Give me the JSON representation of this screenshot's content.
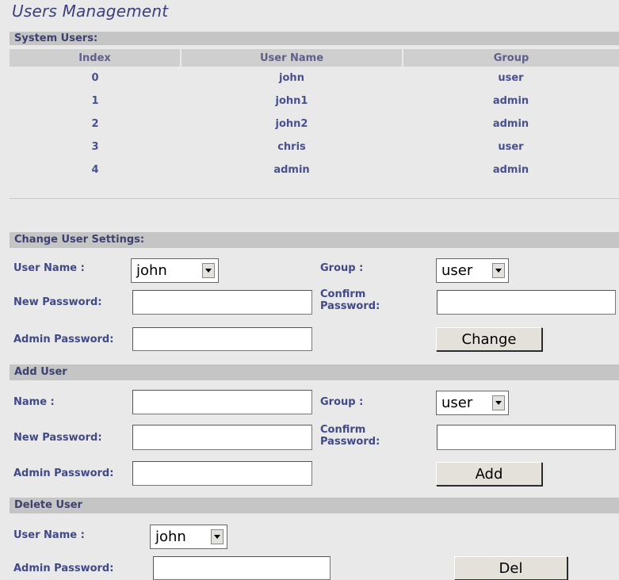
{
  "page": {
    "title": "Users Management"
  },
  "system_users": {
    "header": "System Users:",
    "columns": [
      "Index",
      "User Name",
      "Group"
    ],
    "rows": [
      [
        "0",
        "john",
        "user"
      ],
      [
        "1",
        "john1",
        "admin"
      ],
      [
        "2",
        "john2",
        "admin"
      ],
      [
        "3",
        "chris",
        "user"
      ],
      [
        "4",
        "admin",
        "admin"
      ]
    ]
  },
  "change_user": {
    "header": "Change User Settings:",
    "user_name_label": "User Name :",
    "user_name_value": "john",
    "group_label": "Group :",
    "group_value": "user",
    "new_password_label": "New Password:",
    "confirm_password_label_1": "Confirm",
    "confirm_password_label_2": "Password:",
    "admin_password_label": "Admin Password:",
    "button_label": "Change"
  },
  "add_user": {
    "header": "Add User",
    "name_label": "Name :",
    "group_label": "Group :",
    "group_value": "user",
    "new_password_label": "New Password:",
    "confirm_password_label_1": "Confirm",
    "confirm_password_label_2": "Password:",
    "admin_password_label": "Admin Password:",
    "button_label": "Add"
  },
  "delete_user": {
    "header": "Delete User",
    "user_name_label": "User Name :",
    "user_name_value": "john",
    "admin_password_label": "Admin Password:",
    "button_label": "Del"
  }
}
